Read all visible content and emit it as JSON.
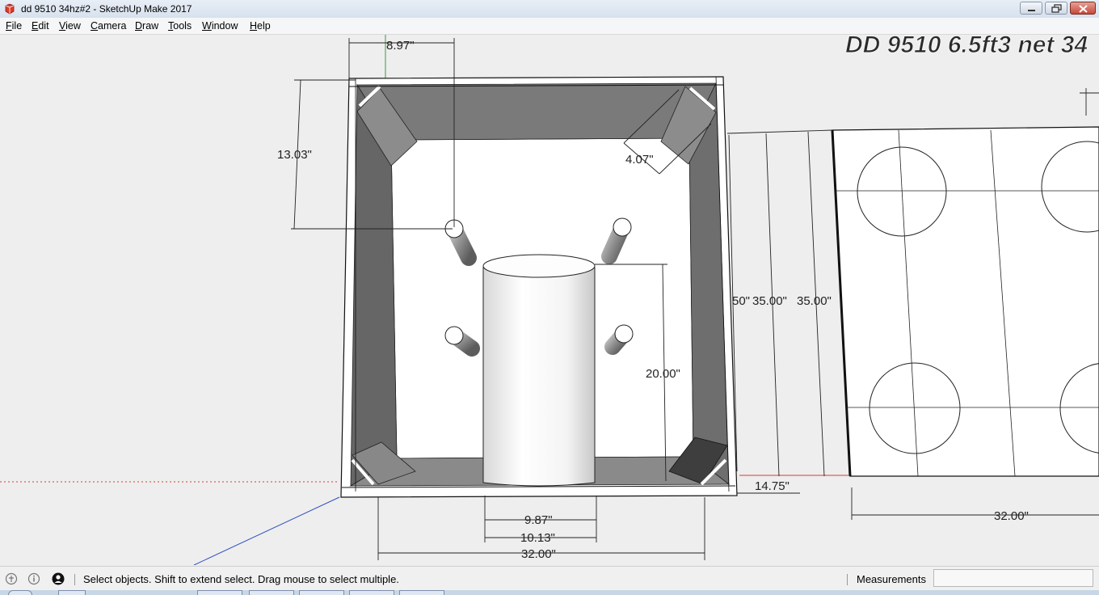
{
  "window": {
    "title": "dd 9510 34hz#2 - SketchUp Make 2017",
    "icon": "sketchup-logo-icon",
    "controls": [
      "minimize-icon",
      "restore-icon",
      "close-icon"
    ]
  },
  "menu": {
    "items": [
      "File",
      "Edit",
      "View",
      "Camera",
      "Draw",
      "Tools",
      "Window",
      "Help"
    ]
  },
  "viewport": {
    "model_title": "DD 9510 6.5ft3 net 34",
    "dimensions": {
      "top_offset": "8.97\"",
      "left_height": "13.03\"",
      "brace_corner": "4.07\"",
      "port_height": "20.00\"",
      "side_partial": "50\"",
      "side_height_a": "35.00\"",
      "side_height_b": "35.00\"",
      "side_depth": "14.75\"",
      "port_inner": "9.87\"",
      "port_outer": "10.13\"",
      "front_width": "32.00\"",
      "panel_width": "32.00\""
    }
  },
  "status": {
    "icons": [
      "geo-location-icon",
      "credits-icon",
      "user-account-icon"
    ],
    "message": "Select objects. Shift to extend select. Drag mouse to select multiple.",
    "measurements_label": "Measurements",
    "measurements_value": ""
  },
  "colors": {
    "viewport_bg": "#eeeeee",
    "panel_dark": "#777777",
    "panel_face": "#ffffff",
    "axis_red": "#d04030",
    "axis_green": "#3a9a3a",
    "axis_blue": "#3050c0"
  }
}
